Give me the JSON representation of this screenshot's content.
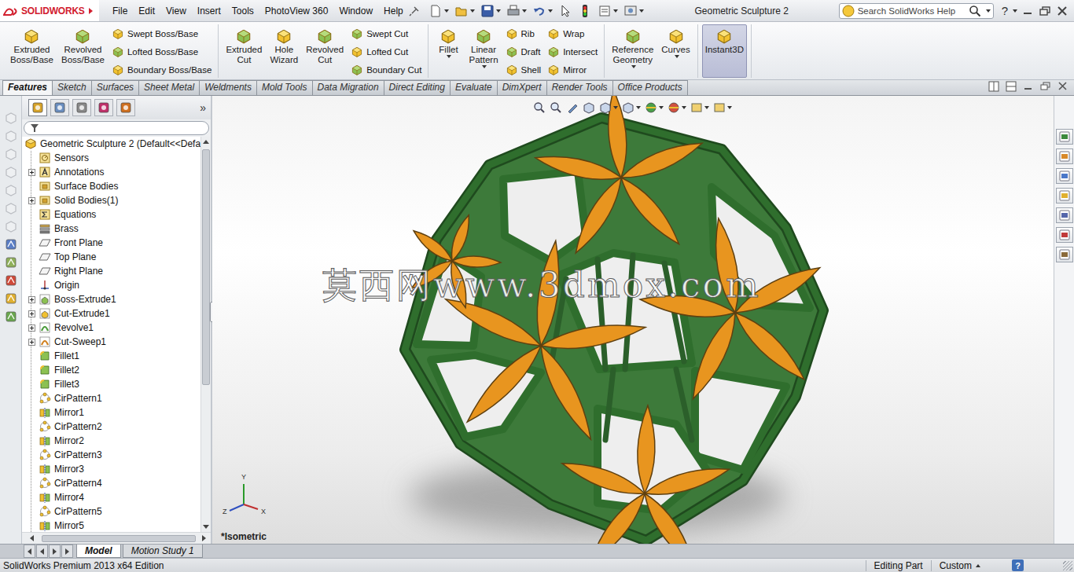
{
  "window": {
    "title": "Geometric Sculpture 2"
  },
  "logo": {
    "text": "SOLIDWORKS"
  },
  "menu": [
    "File",
    "Edit",
    "View",
    "Insert",
    "Tools",
    "PhotoView 360",
    "Window",
    "Help"
  ],
  "search": {
    "placeholder": "Search SolidWorks Help"
  },
  "window_help": "?",
  "command_groups": [
    {
      "items": [
        {
          "kind": "big",
          "lines": [
            "Extruded",
            "Boss/Base"
          ],
          "selected": false,
          "dropdown": false
        },
        {
          "kind": "big",
          "lines": [
            "Revolved",
            "Boss/Base"
          ],
          "selected": false,
          "dropdown": false
        },
        {
          "kind": "stack",
          "labels": [
            "Swept Boss/Base",
            "Lofted Boss/Base",
            "Boundary Boss/Base"
          ]
        }
      ]
    },
    {
      "items": [
        {
          "kind": "big",
          "lines": [
            "Extruded",
            "Cut"
          ],
          "selected": false,
          "dropdown": false
        },
        {
          "kind": "big",
          "lines": [
            "Hole",
            "Wizard"
          ],
          "selected": false,
          "dropdown": false
        },
        {
          "kind": "big",
          "lines": [
            "Revolved",
            "Cut"
          ],
          "selected": false,
          "dropdown": false
        },
        {
          "kind": "stack",
          "labels": [
            "Swept Cut",
            "Lofted Cut",
            "Boundary Cut"
          ]
        }
      ]
    },
    {
      "items": [
        {
          "kind": "big",
          "lines": [
            "Fillet"
          ],
          "selected": false,
          "dropdown": true
        },
        {
          "kind": "big",
          "lines": [
            "Linear",
            "Pattern"
          ],
          "selected": false,
          "dropdown": true
        },
        {
          "kind": "stack",
          "labels": [
            "Rib",
            "Draft",
            "Shell"
          ]
        },
        {
          "kind": "stack",
          "labels": [
            "Wrap",
            "Intersect",
            "Mirror"
          ]
        }
      ]
    },
    {
      "items": [
        {
          "kind": "big",
          "lines": [
            "Reference",
            "Geometry"
          ],
          "selected": false,
          "dropdown": true
        },
        {
          "kind": "big",
          "lines": [
            "Curves"
          ],
          "selected": false,
          "dropdown": true
        }
      ]
    },
    {
      "items": [
        {
          "kind": "big",
          "lines": [
            "Instant3D"
          ],
          "selected": true,
          "dropdown": false
        }
      ]
    }
  ],
  "tabs": [
    {
      "label": "Features",
      "selected": true
    },
    {
      "label": "Sketch",
      "selected": false
    },
    {
      "label": "Surfaces",
      "selected": false
    },
    {
      "label": "Sheet Metal",
      "selected": false
    },
    {
      "label": "Weldments",
      "selected": false
    },
    {
      "label": "Mold Tools",
      "selected": false
    },
    {
      "label": "Data Migration",
      "selected": false
    },
    {
      "label": "Direct Editing",
      "selected": false
    },
    {
      "label": "Evaluate",
      "selected": false
    },
    {
      "label": "DimXpert",
      "selected": false
    },
    {
      "label": "Render Tools",
      "selected": false
    },
    {
      "label": "Office Products",
      "selected": false
    }
  ],
  "feature_manager": {
    "more": "»",
    "tree": [
      {
        "label": "Geometric Sculpture 2 (Default<<Defa",
        "kind": "part",
        "root": true,
        "expandable": false
      },
      {
        "label": "Sensors",
        "kind": "sensors",
        "root": false,
        "expandable": false
      },
      {
        "label": "Annotations",
        "kind": "annotations",
        "root": false,
        "expandable": true
      },
      {
        "label": "Surface Bodies",
        "kind": "bodies",
        "root": false,
        "expandable": false
      },
      {
        "label": "Solid Bodies(1)",
        "kind": "bodies",
        "root": false,
        "expandable": true
      },
      {
        "label": "Equations",
        "kind": "equations",
        "root": false,
        "expandable": false
      },
      {
        "label": "Brass",
        "kind": "material",
        "root": false,
        "expandable": false
      },
      {
        "label": "Front Plane",
        "kind": "plane",
        "root": false,
        "expandable": false
      },
      {
        "label": "Top Plane",
        "kind": "plane",
        "root": false,
        "expandable": false
      },
      {
        "label": "Right Plane",
        "kind": "plane",
        "root": false,
        "expandable": false
      },
      {
        "label": "Origin",
        "kind": "origin",
        "root": false,
        "expandable": false
      },
      {
        "label": "Boss-Extrude1",
        "kind": "extrude",
        "root": false,
        "expandable": true
      },
      {
        "label": "Cut-Extrude1",
        "kind": "cut",
        "root": false,
        "expandable": true
      },
      {
        "label": "Revolve1",
        "kind": "revolve",
        "root": false,
        "expandable": true
      },
      {
        "label": "Cut-Sweep1",
        "kind": "sweep",
        "root": false,
        "expandable": true
      },
      {
        "label": "Fillet1",
        "kind": "fillet",
        "root": false,
        "expandable": false
      },
      {
        "label": "Fillet2",
        "kind": "fillet",
        "root": false,
        "expandable": false
      },
      {
        "label": "Fillet3",
        "kind": "fillet",
        "root": false,
        "expandable": false
      },
      {
        "label": "CirPattern1",
        "kind": "pattern",
        "root": false,
        "expandable": false
      },
      {
        "label": "Mirror1",
        "kind": "mirror",
        "root": false,
        "expandable": false
      },
      {
        "label": "CirPattern2",
        "kind": "pattern",
        "root": false,
        "expandable": false
      },
      {
        "label": "Mirror2",
        "kind": "mirror",
        "root": false,
        "expandable": false
      },
      {
        "label": "CirPattern3",
        "kind": "pattern",
        "root": false,
        "expandable": false
      },
      {
        "label": "Mirror3",
        "kind": "mirror",
        "root": false,
        "expandable": false
      },
      {
        "label": "CirPattern4",
        "kind": "pattern",
        "root": false,
        "expandable": false
      },
      {
        "label": "Mirror4",
        "kind": "mirror",
        "root": false,
        "expandable": false
      },
      {
        "label": "CirPattern5",
        "kind": "pattern",
        "root": false,
        "expandable": false
      },
      {
        "label": "Mirror5",
        "kind": "mirror",
        "root": false,
        "expandable": false
      }
    ]
  },
  "viewport": {
    "watermark": "莫西网www.3dmox.com",
    "view_name": "*Isometric",
    "axes": [
      "Y",
      "Z",
      "X"
    ]
  },
  "bottom_tabs": [
    {
      "label": "Model",
      "selected": true
    },
    {
      "label": "Motion Study 1",
      "selected": false
    }
  ],
  "status_bar": {
    "product": "SolidWorks Premium 2013 x64 Edition",
    "mode": "Editing Part",
    "units": "Custom",
    "help": "?"
  }
}
